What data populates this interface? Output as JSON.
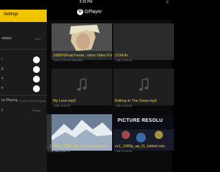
{
  "status_bar": {
    "time": "9:30 PM"
  },
  "app": {
    "name": "GPlayer"
  },
  "settings": {
    "title": "Settings",
    "rows": [
      {
        "label": "ntation",
        "value": "Auto"
      },
      {
        "label": "r"
      },
      {
        "label": "g"
      },
      {
        "label": "e"
      },
      {
        "label": "e"
      },
      {
        "label": "eo Playing",
        "value": "Choose What Playing"
      },
      {
        "label": "y",
        "value": "Glossy"
      }
    ]
  },
  "media": [
    {
      "title": "1080P(Final Fanta...otion Video P.mp4",
      "meta": "1 MB  |  00:00:08    1920x1080",
      "kind": "video"
    },
    {
      "title": "1234.flv",
      "meta": "1 MB  |  00:00:08",
      "kind": "video"
    },
    {
      "title": "My Love.mp3",
      "meta": "1 MB  |  00:00:08",
      "kind": "audio"
    },
    {
      "title": "Rolling In The Deep.mp3",
      "meta": "1 MB  |  00:00:08",
      "kind": "audio"
    },
    {
      "title": "_hp_5.1_harry_potter.mkv",
      "meta": "1 MB  |  00:00:08",
      "kind": "video"
    },
    {
      "title": "h264_720p_hp_5.1_planet.mp4",
      "meta": "1 MB  |  00:00:08",
      "kind": "video"
    },
    {
      "title": "vc1_1080p_ap_l3_hddvd.mkv",
      "meta": "1 MB  |  00:00:08",
      "kind": "video"
    }
  ],
  "overlay_text": {
    "picture_resolution": "PICTURE RESOLU"
  }
}
